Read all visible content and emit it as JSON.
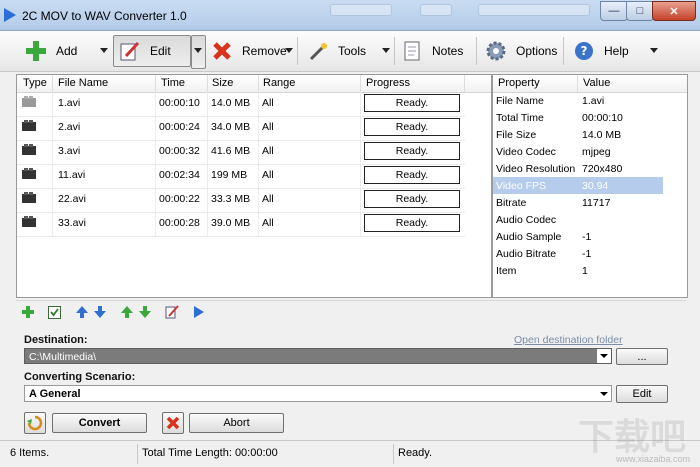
{
  "window": {
    "title": "2C MOV to WAV Converter 1.0",
    "min": "—",
    "max": "□",
    "close": "✕"
  },
  "toolbar": {
    "add": "Add",
    "edit": "Edit",
    "remove": "Remove",
    "tools": "Tools",
    "notes": "Notes",
    "options": "Options",
    "help": "Help"
  },
  "columns": {
    "type": "Type",
    "name": "File Name",
    "time": "Time",
    "size": "Size",
    "range": "Range",
    "progress": "Progress"
  },
  "files": [
    {
      "name": "1.avi",
      "time": "00:00:10",
      "size": "14.0 MB",
      "range": "All",
      "progress": "Ready."
    },
    {
      "name": "2.avi",
      "time": "00:00:24",
      "size": "34.0 MB",
      "range": "All",
      "progress": "Ready."
    },
    {
      "name": "3.avi",
      "time": "00:00:32",
      "size": "41.6 MB",
      "range": "All",
      "progress": "Ready."
    },
    {
      "name": "11.avi",
      "time": "00:02:34",
      "size": "199 MB",
      "range": "All",
      "progress": "Ready."
    },
    {
      "name": "22.avi",
      "time": "00:00:22",
      "size": "33.3 MB",
      "range": "All",
      "progress": "Ready."
    },
    {
      "name": "33.avi",
      "time": "00:00:28",
      "size": "39.0 MB",
      "range": "All",
      "progress": "Ready."
    }
  ],
  "props": {
    "header_property": "Property",
    "header_value": "Value",
    "rows": [
      {
        "name": "File Name",
        "value": "1.avi"
      },
      {
        "name": "Total Time",
        "value": "00:00:10"
      },
      {
        "name": "File Size",
        "value": "14.0 MB"
      },
      {
        "name": "Video Codec",
        "value": "mjpeg"
      },
      {
        "name": "Video Resolution",
        "value": "720x480"
      },
      {
        "name": "Video FPS",
        "value": "30.94"
      },
      {
        "name": "Bitrate",
        "value": "11717"
      },
      {
        "name": "Audio Codec",
        "value": ""
      },
      {
        "name": "Audio Sample",
        "value": "-1"
      },
      {
        "name": "Audio Bitrate",
        "value": "-1"
      },
      {
        "name": "Item",
        "value": "1"
      }
    ]
  },
  "destination": {
    "label": "Destination:",
    "value": "C:\\Multimedia\\",
    "open_link": "Open destination folder",
    "browse": "..."
  },
  "scenario": {
    "label": "Converting Scenario:",
    "value": "A General",
    "edit": "Edit"
  },
  "actions": {
    "convert": "Convert",
    "abort": "Abort"
  },
  "status": {
    "items": "6 Items.",
    "total": "Total Time Length: 00:00:00",
    "state": "Ready."
  },
  "watermark": {
    "brand": "下载吧",
    "url": "www.xiazaiba.com"
  }
}
